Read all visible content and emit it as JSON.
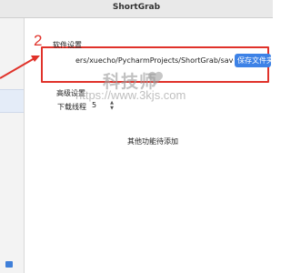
{
  "window": {
    "title": "ShortGrab"
  },
  "annotation": {
    "step_number": "2"
  },
  "software_settings": {
    "heading": "软件设置",
    "save_path": "ers/xuecho/PycharmProjects/ShortGrab/save_video",
    "save_folder_button": "保存文件夹"
  },
  "advanced_settings": {
    "heading": "高级设置",
    "download_threads_label": "下载线程",
    "download_threads_value": "5"
  },
  "footer": {
    "more_features": "其他功能待添加"
  },
  "watermark": {
    "logo_text": "科技师",
    "url": "https://www.3kjs.com"
  },
  "colors": {
    "accent_blue": "#3d82e6",
    "annotation_red": "#e0322a"
  }
}
